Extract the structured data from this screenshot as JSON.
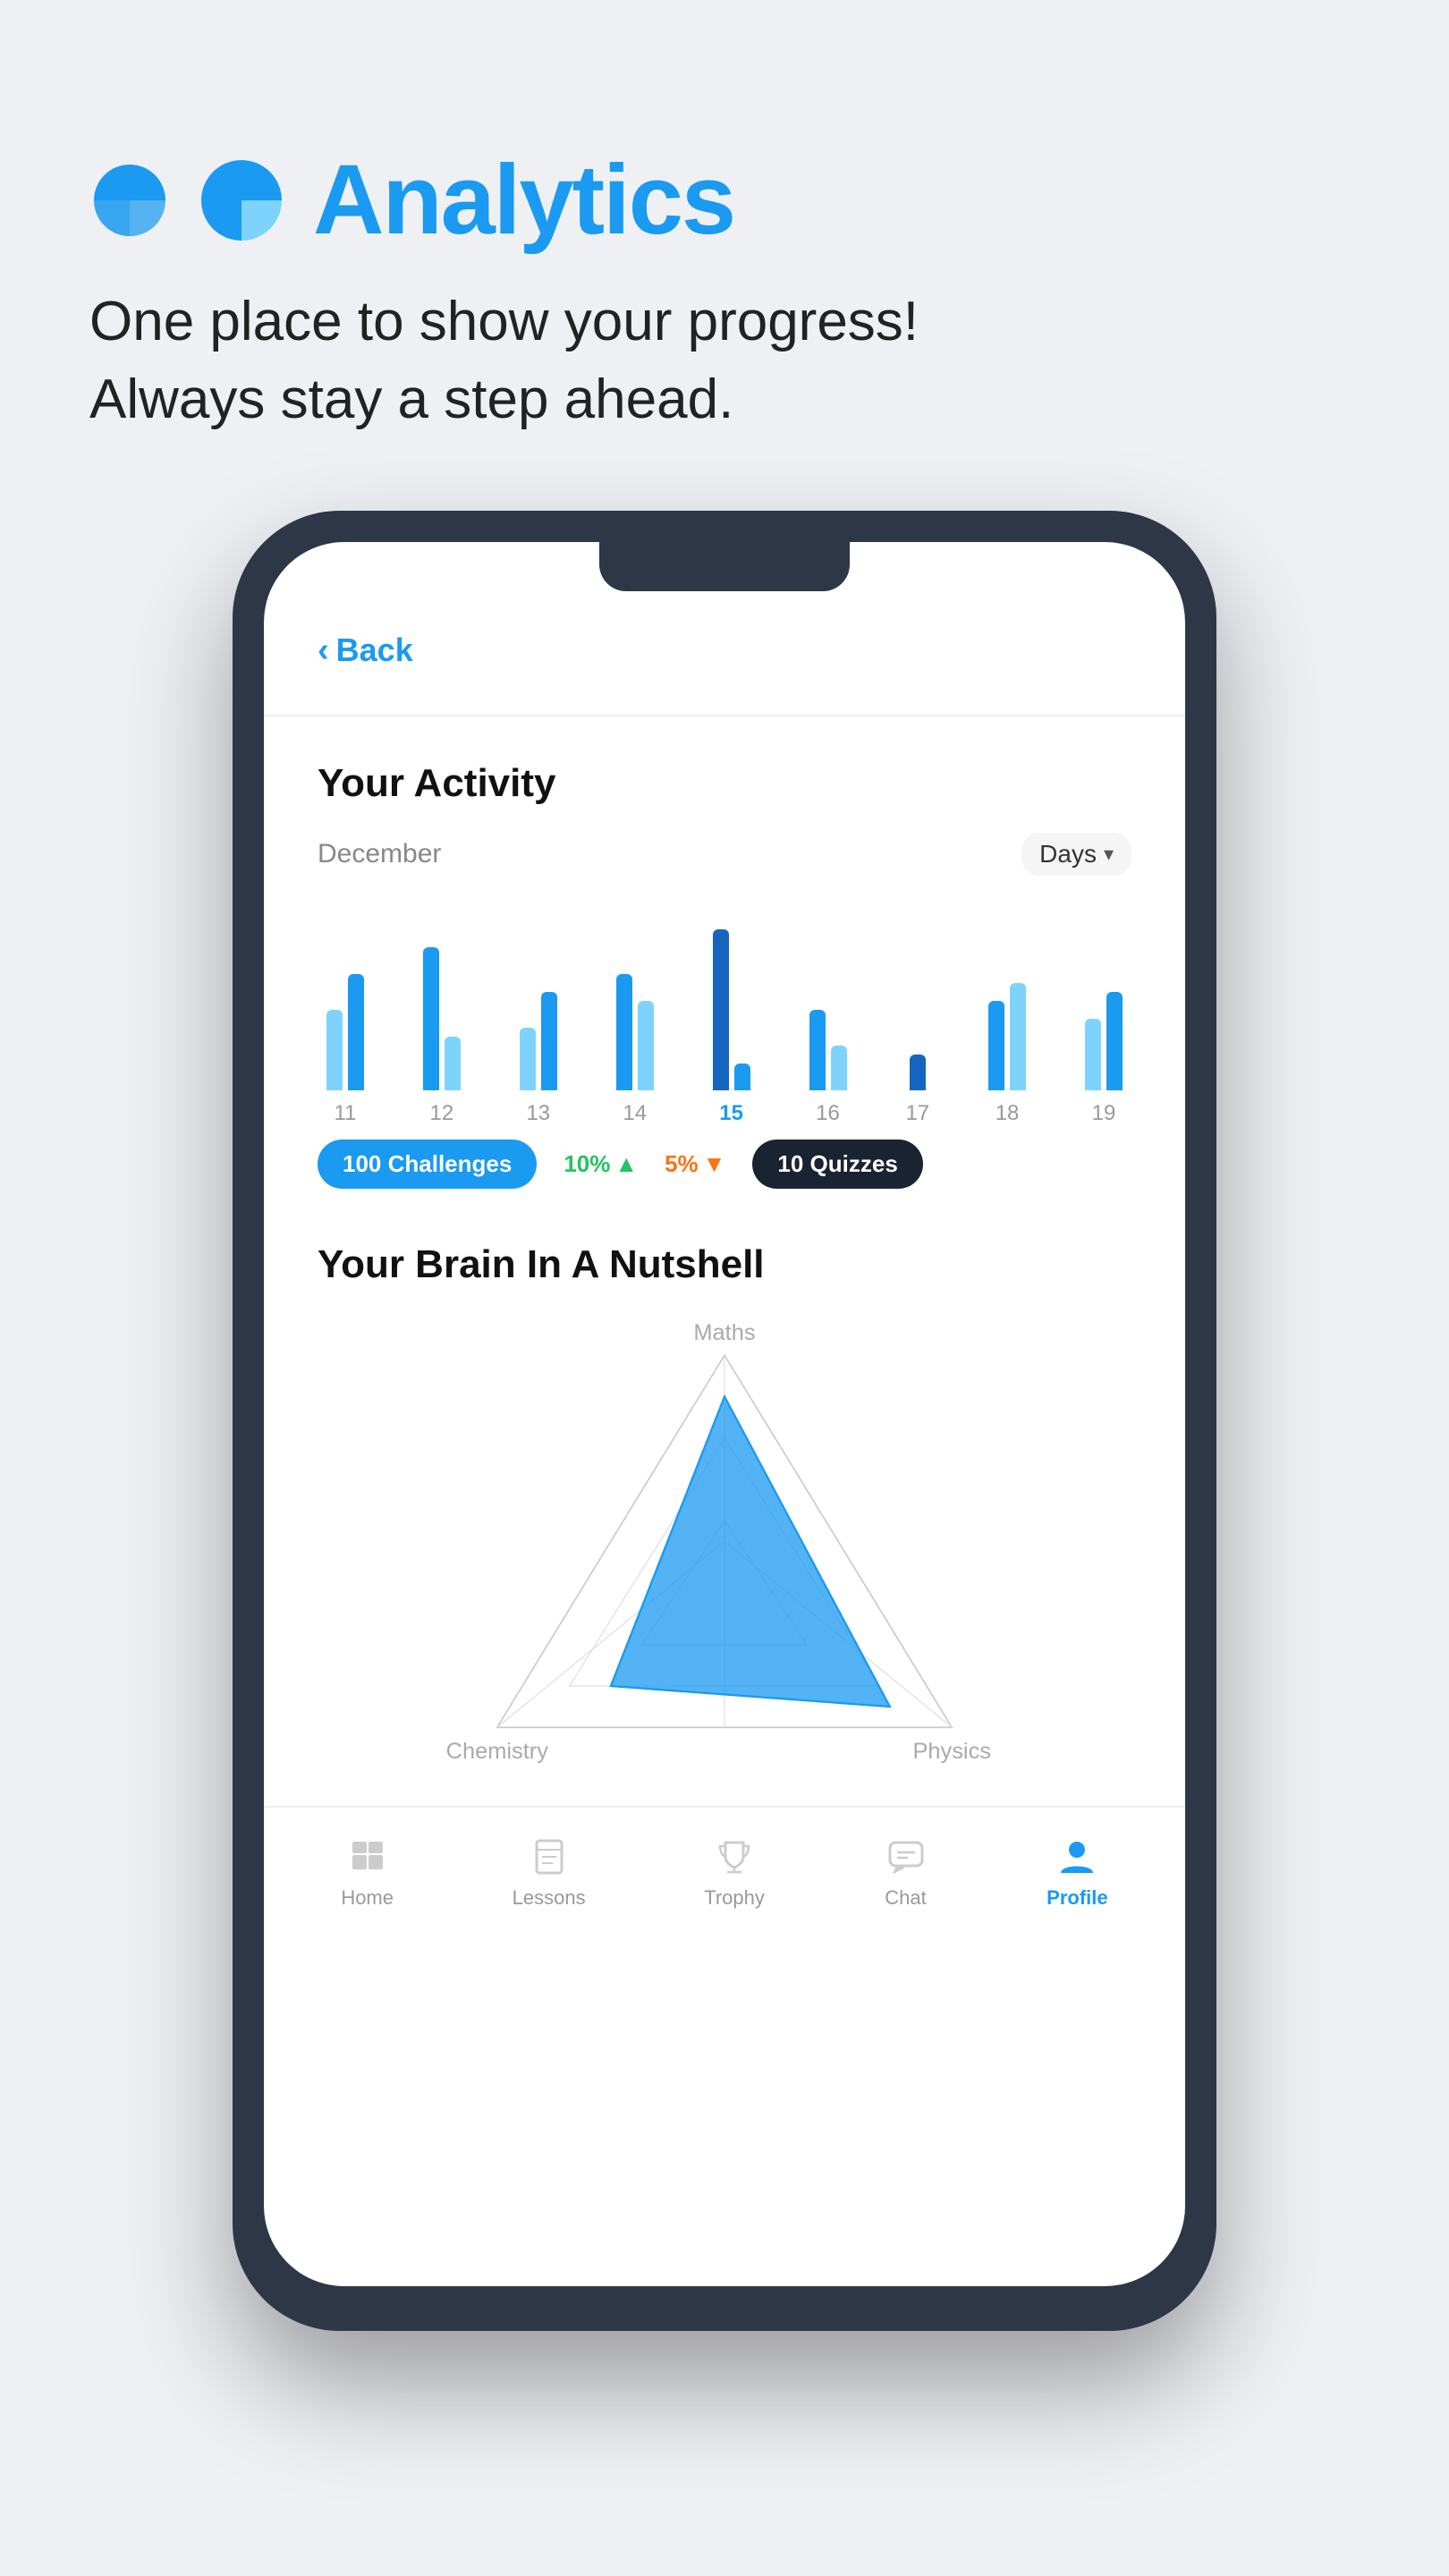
{
  "page": {
    "background": "#eef0f3"
  },
  "header": {
    "icon_label": "analytics-pie-icon",
    "title": "Analytics",
    "subtitle_line1": "One place to show your progress!",
    "subtitle_line2": "Always stay a step ahead."
  },
  "phone": {
    "back_button": "Back",
    "activity_section": {
      "title": "Your Activity",
      "month": "December",
      "filter": "Days",
      "bars": [
        {
          "day": "11",
          "heights": [
            90,
            140
          ],
          "active": false
        },
        {
          "day": "12",
          "heights": [
            160,
            60
          ],
          "active": false
        },
        {
          "day": "13",
          "heights": [
            70,
            110
          ],
          "active": false
        },
        {
          "day": "14",
          "heights": [
            130,
            100
          ],
          "active": false
        },
        {
          "day": "15",
          "heights": [
            180,
            30
          ],
          "active": true
        },
        {
          "day": "16",
          "heights": [
            90,
            50
          ],
          "active": false
        },
        {
          "day": "17",
          "heights": [
            40,
            0
          ],
          "active": false
        },
        {
          "day": "18",
          "heights": [
            100,
            120
          ],
          "active": false
        },
        {
          "day": "19",
          "heights": [
            80,
            110
          ],
          "active": false
        }
      ],
      "stats": {
        "challenges": "100 Challenges",
        "change_up": "10%",
        "change_down": "5%",
        "quizzes": "10 Quizzes"
      }
    },
    "brain_section": {
      "title": "Your Brain In A Nutshell",
      "labels": {
        "maths": "Maths",
        "chemistry": "Chemistry",
        "physics": "Physics"
      }
    },
    "bottom_nav": {
      "items": [
        {
          "label": "Home",
          "active": false,
          "icon": "home-icon"
        },
        {
          "label": "Lessons",
          "active": false,
          "icon": "book-icon"
        },
        {
          "label": "Trophy",
          "active": false,
          "icon": "trophy-icon"
        },
        {
          "label": "Chat",
          "active": false,
          "icon": "chat-icon"
        },
        {
          "label": "Profile",
          "active": true,
          "icon": "profile-icon"
        }
      ]
    }
  }
}
